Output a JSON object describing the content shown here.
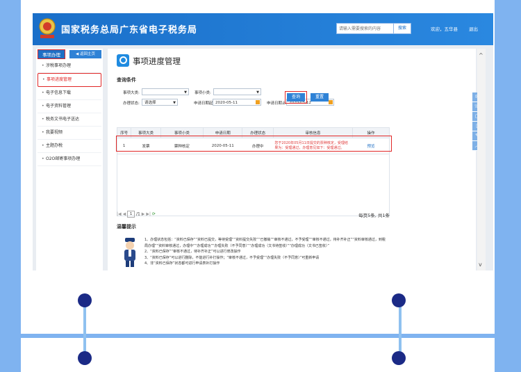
{
  "header": {
    "site_title": "国家税务总局广东省电子税务局",
    "search_placeholder": "请输入需要搜索的内容",
    "search_button": "搜索",
    "welcome": "欢迎，五华县",
    "logout": "退出"
  },
  "sidebar": {
    "tab_label": "事项办理",
    "back_label": "返回主页",
    "items": [
      {
        "label": "涉税事项办理"
      },
      {
        "label": "事项进度管理"
      },
      {
        "label": "电子信息下载"
      },
      {
        "label": "电子资料管理"
      },
      {
        "label": "税务文书电子送达"
      },
      {
        "label": "我要视频"
      },
      {
        "label": "主题办税"
      },
      {
        "label": "O2O邮寄事项办理"
      }
    ]
  },
  "main": {
    "page_title": "事项进度管理",
    "query_section": "查询条件",
    "filters": {
      "type_label": "事项大类:",
      "subtype_label": "事项小类:",
      "status_label": "办理状态:",
      "status_value": "请选择",
      "start_label": "申请日期起:",
      "start_value": "2020-05-11",
      "end_label": "申请日期止:",
      "end_value": "2020-05-12"
    },
    "query_button": "查询",
    "reset_button": "重置",
    "table": {
      "headers": [
        "序号",
        "事项大类",
        "事项小类",
        "申请日期",
        "办理状态",
        "审核信息",
        "操作"
      ],
      "rows": [
        {
          "no": "1",
          "type": "发票",
          "subtype": "票种核定",
          "date": "2020-05-11",
          "status": "办理中",
          "message": "您于2020年05月11日提交的票种核定，受理结果为：受理通过，办理意见如下：受理通过。",
          "action": "预览"
        }
      ]
    },
    "pager": {
      "page": "1",
      "total_pages": "/1",
      "summary": "每页5条, 共1条"
    },
    "tips_label": "温馨提示",
    "tips": [
      "1、办理状态包括：“资料已保存”“资料已提交，等待受理”“资料提交失败”“已撤销”“审核不通过，不予受理”“审核不通过，待补齐补正”“资料审核通过，到税局办理”“资料审核通过，办理中”“办理成功”“办理失败（不予同意）”“办理成功（文书待签收）”“办理成功（文书已签收）”",
      "2、“资料已保存”“审核不通过，待补齐补正”可以进行修改操作",
      "3、“资料已保存”可以进行删除，不能进行补打操作；“审核不通过，不予受理”“办理失败（不予同意）”可重新申请",
      "4、非“资料已保存”状态都可进行申请表补打操作"
    ]
  }
}
